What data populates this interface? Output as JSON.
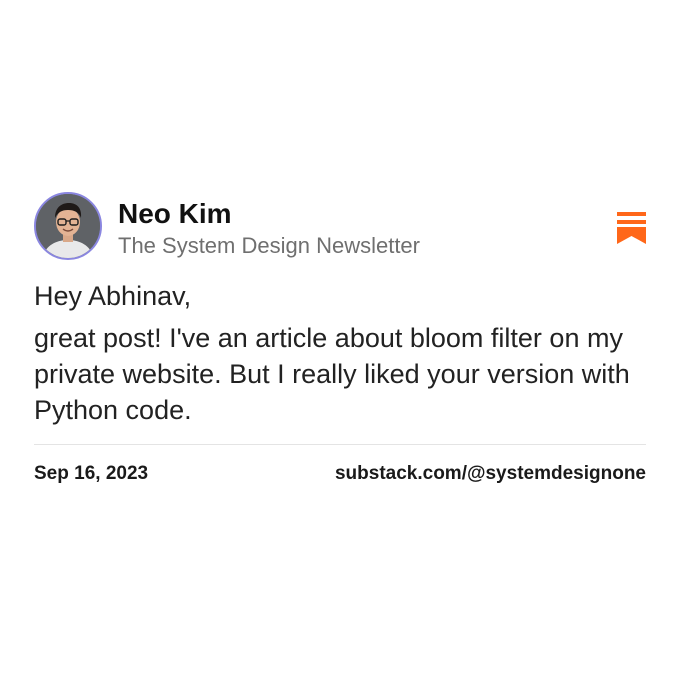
{
  "author": {
    "name": "Neo Kim",
    "publication": "The System Design Newsletter"
  },
  "message": {
    "greeting": "Hey Abhinav,",
    "body": "great post! I've an article about bloom filter on my private website. But I really liked your version with Python code."
  },
  "footer": {
    "date": "Sep 16, 2023",
    "link": "substack.com/@systemdesignone"
  },
  "icons": {
    "avatar": "profile-photo",
    "bookmark": "substack-logo-icon"
  },
  "colors": {
    "accent": "#ff6719",
    "avatar_ring": "#8a86e0",
    "secondary_text": "#6f6f6f"
  }
}
